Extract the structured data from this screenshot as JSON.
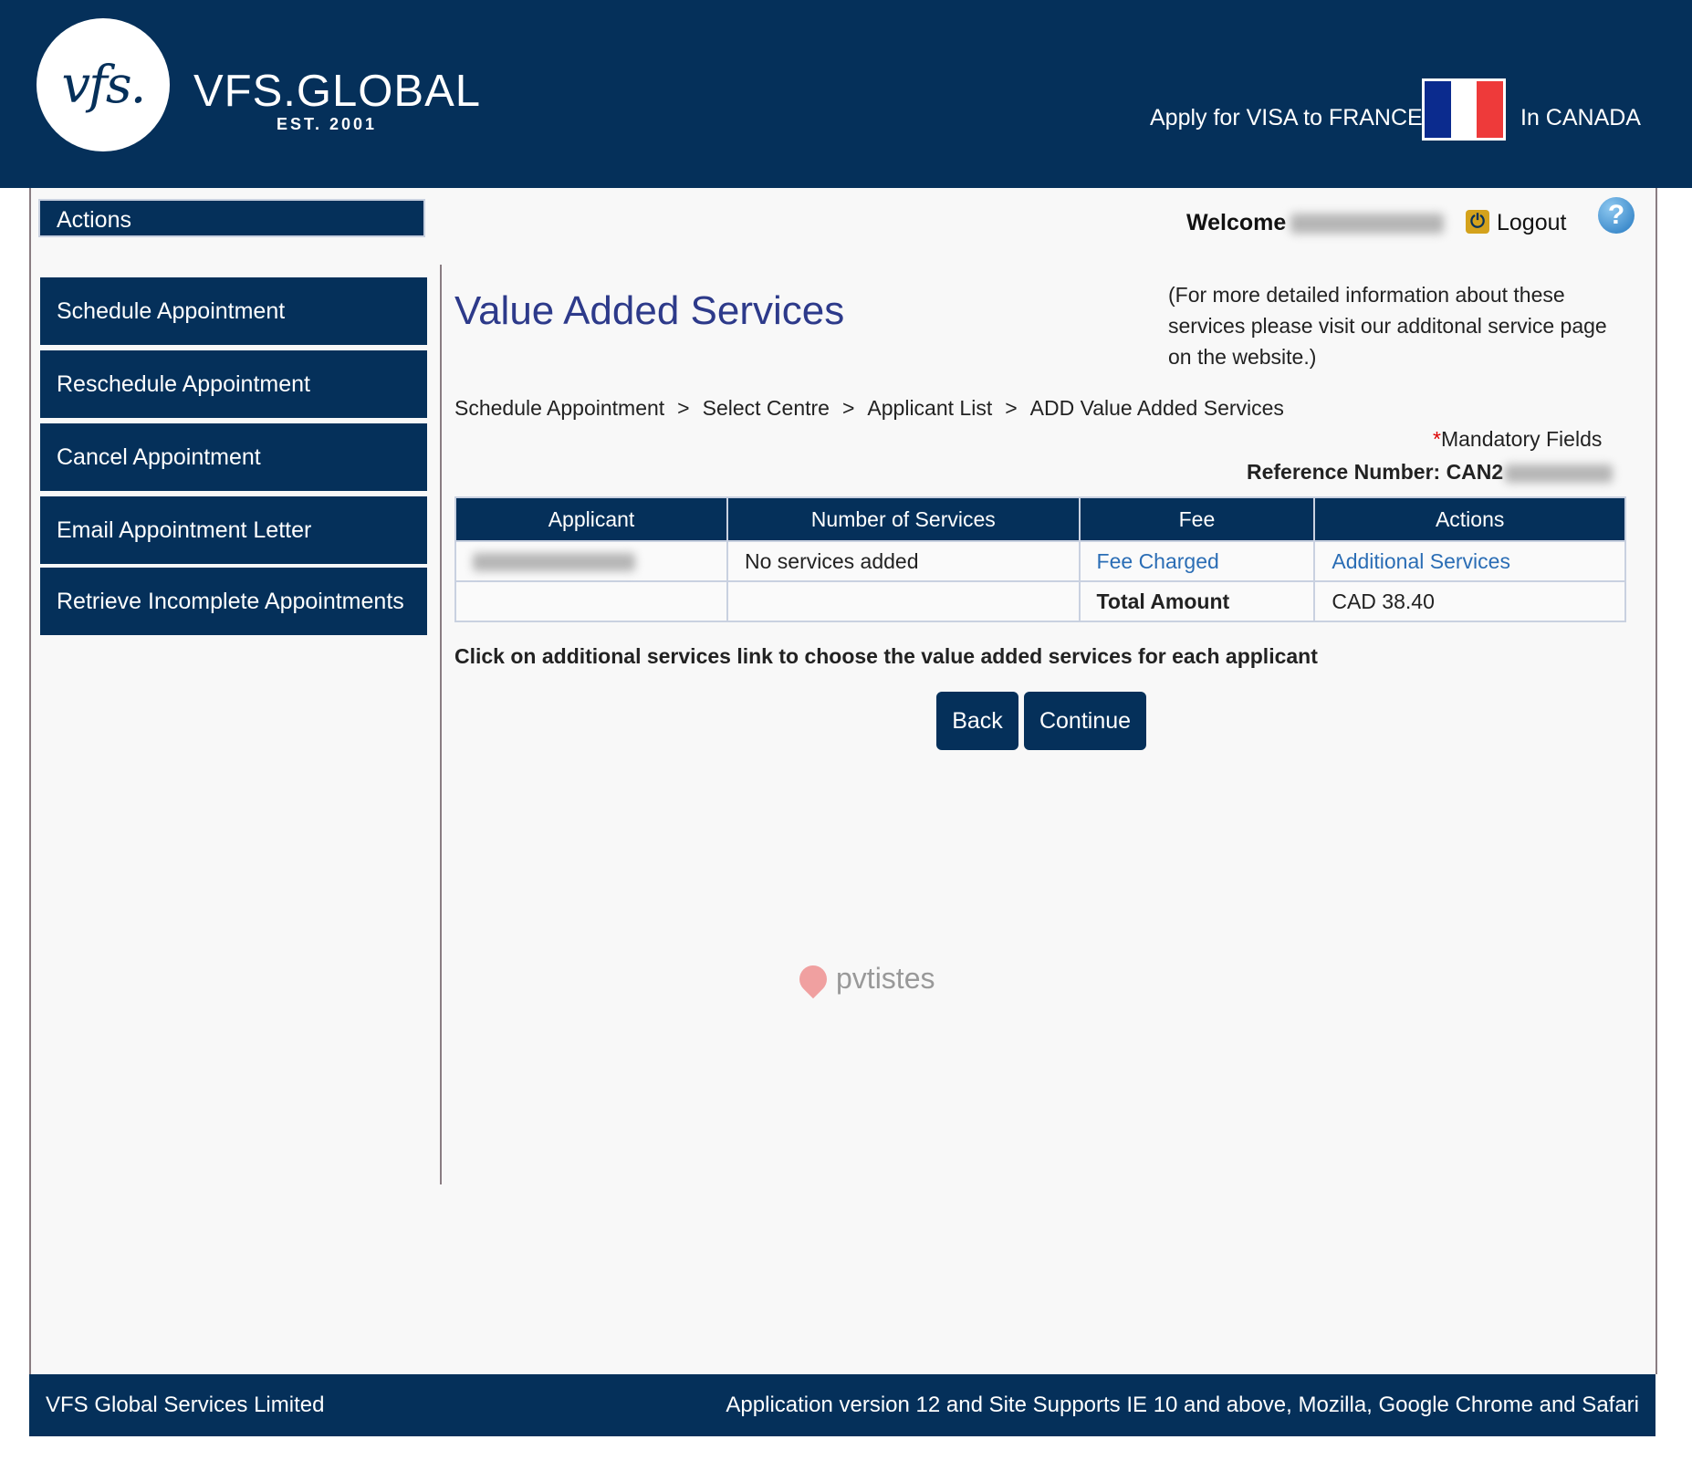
{
  "header": {
    "logo_mark": "vfs.",
    "brand_name": "VFS.GLOBAL",
    "brand_est": "EST. 2001",
    "apply_text": "Apply for VISA to FRANCE",
    "country_text": "In CANADA"
  },
  "sidebar": {
    "header": "Actions",
    "items": [
      {
        "label": "Schedule Appointment"
      },
      {
        "label": "Reschedule Appointment"
      },
      {
        "label": "Cancel Appointment"
      },
      {
        "label": "Email Appointment Letter"
      },
      {
        "label": "Retrieve Incomplete Appointments"
      }
    ]
  },
  "user": {
    "welcome_label": "Welcome",
    "logout_label": "Logout",
    "help_symbol": "?"
  },
  "main": {
    "title": "Value Added Services",
    "info": "(For more detailed information about these services please visit our additonal service page on the website.)",
    "breadcrumb": [
      "Schedule Appointment",
      "Select Centre",
      "Applicant List",
      "ADD Value Added Services"
    ],
    "breadcrumb_separator": ">",
    "mandatory_star": "*",
    "mandatory_text": "Mandatory Fields",
    "reference_label": "Reference Number: CAN2",
    "table": {
      "headers": [
        "Applicant",
        "Number of Services",
        "Fee",
        "Actions"
      ],
      "row": {
        "services": "No services added",
        "fee_link": "Fee Charged",
        "action_link": "Additional Services"
      },
      "total_label": "Total Amount",
      "total_value": "CAD 38.40"
    },
    "instruction": "Click on additional services link to choose the value added services for each applicant",
    "back_label": "Back",
    "continue_label": "Continue"
  },
  "watermark": "pvtistes",
  "footer": {
    "left": "VFS Global Services Limited",
    "right": "Application version 12 and Site Supports IE 10 and above, Mozilla, Google Chrome and Safari"
  },
  "colors": {
    "primary": "#05305a",
    "title": "#2d3a8a",
    "link": "#2a6db5",
    "flag_blue": "#0b2b8e",
    "flag_red": "#ee3a3a"
  }
}
